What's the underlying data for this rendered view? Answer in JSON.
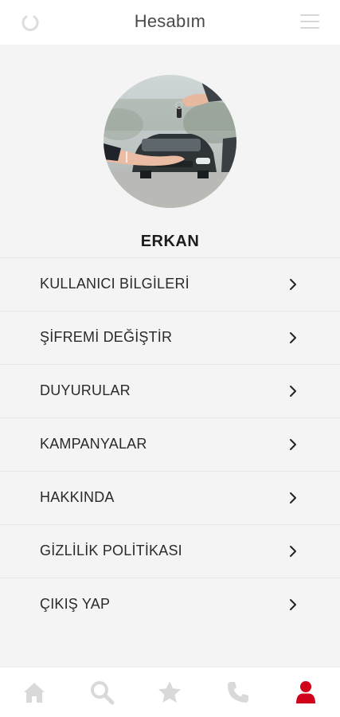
{
  "header": {
    "title": "Hesabım",
    "logo_icon": "ring-logo-icon",
    "menu_icon": "hamburger-menu-icon"
  },
  "profile": {
    "name": "ERKAN",
    "avatar": "car-key-handover-photo"
  },
  "menu": {
    "items": [
      {
        "label": "KULLANICI BİLGİLERİ"
      },
      {
        "label": "ŞİFREMİ DEĞİŞTİR"
      },
      {
        "label": "DUYURULAR"
      },
      {
        "label": "KAMPANYALAR"
      },
      {
        "label": "HAKKINDA"
      },
      {
        "label": "GİZLİLİK POLİTİKASI"
      },
      {
        "label": "ÇIKIŞ YAP"
      }
    ],
    "chevron_icon": "chevron-right-icon"
  },
  "bottom_nav": {
    "items": [
      {
        "icon": "home-icon",
        "active": false
      },
      {
        "icon": "search-icon",
        "active": false
      },
      {
        "icon": "star-icon",
        "active": false
      },
      {
        "icon": "phone-icon",
        "active": false
      },
      {
        "icon": "user-icon",
        "active": true
      }
    ],
    "colors": {
      "inactive": "#d9d9d9",
      "active": "#d0021b"
    }
  }
}
